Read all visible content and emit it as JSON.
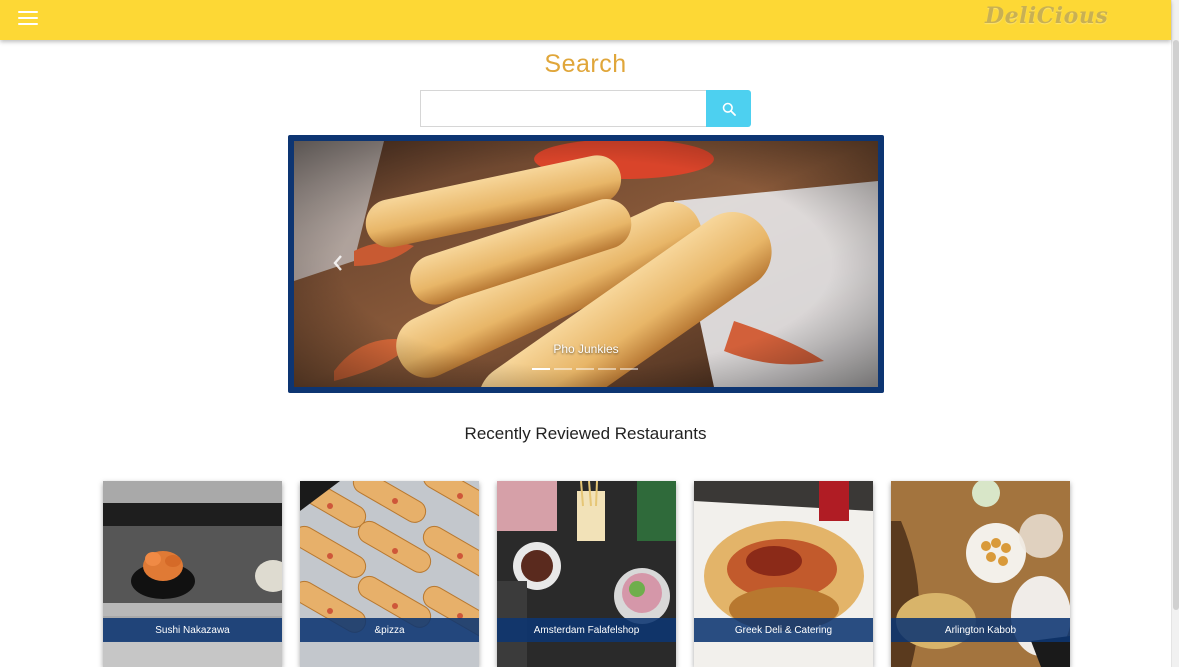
{
  "navbar": {
    "menu_icon": "hamburger-menu-icon",
    "brand": "DeliCious",
    "brand_color": "#fdd835"
  },
  "search": {
    "title": "Search",
    "value": "",
    "placeholder": "",
    "button_icon": "search-icon",
    "button_color": "#4dd0f0"
  },
  "carousel": {
    "caption": "Pho Junkies",
    "prev_icon": "chevron-left-icon",
    "slide_count": 5,
    "active_index": 0,
    "border_color": "#0d3572"
  },
  "recent": {
    "title": "Recently Reviewed Restaurants",
    "restaurants": [
      {
        "name": "Sushi Nakazawa"
      },
      {
        "name": "&pizza"
      },
      {
        "name": "Amsterdam Falafelshop"
      },
      {
        "name": "Greek Deli & Catering"
      },
      {
        "name": "Arlington Kabob"
      }
    ]
  }
}
